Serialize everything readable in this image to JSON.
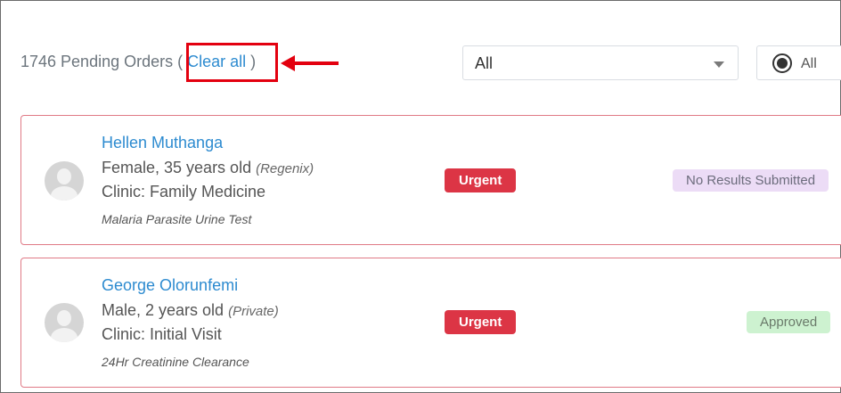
{
  "header": {
    "pending_prefix": "1746 Pending Orders (",
    "clear_all_label": "Clear all",
    "pending_suffix": ")"
  },
  "filters": {
    "select_value": "All",
    "radio_label": "All"
  },
  "orders": [
    {
      "name": "Hellen Muthanga",
      "demographics": "Female, 35 years old",
      "insurer": "(Regenix)",
      "clinic": "Clinic: Family Medicine",
      "test": "Malaria Parasite Urine Test",
      "priority": "Urgent",
      "status": "No Results Submitted"
    },
    {
      "name": "George Olorunfemi",
      "demographics": "Male, 2 years old",
      "insurer": "(Private)",
      "clinic": "Clinic: Initial Visit",
      "test": "24Hr Creatinine Clearance",
      "priority": "Urgent",
      "status": "Approved"
    }
  ],
  "colors": {
    "link": "#2d8bd0",
    "urgent": "#dc3545",
    "card_border": "#e07a86",
    "highlight": "#e3000f",
    "status_pending_bg": "#ecdcf6",
    "status_approved_bg": "#cdf2d0"
  }
}
